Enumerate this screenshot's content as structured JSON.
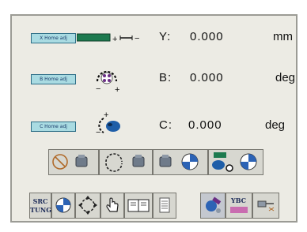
{
  "axes": [
    {
      "button_label": "X Home adj",
      "label": "Y:",
      "value": "0.000",
      "unit": "mm"
    },
    {
      "button_label": "B Home adj",
      "label": "B:",
      "value": "0.000",
      "unit": "deg"
    },
    {
      "button_label": "C Home adj",
      "label": "C:",
      "value": "0.000",
      "unit": "deg"
    }
  ],
  "linear_symbols": {
    "plus": "+",
    "minus": "−"
  },
  "rotary_symbols": {
    "minus": "−",
    "plus": "+"
  },
  "bottom_toolbar": {
    "sync_label_line1": "SRC",
    "sync_label_line2": "TUNG",
    "ybc_label": "YBC"
  },
  "colors": {
    "screen_bg": "#ecebe4",
    "button_bg": "#a9dbe2",
    "accent_green": "#1d7a4f",
    "accent_blue": "#2c63b5"
  }
}
